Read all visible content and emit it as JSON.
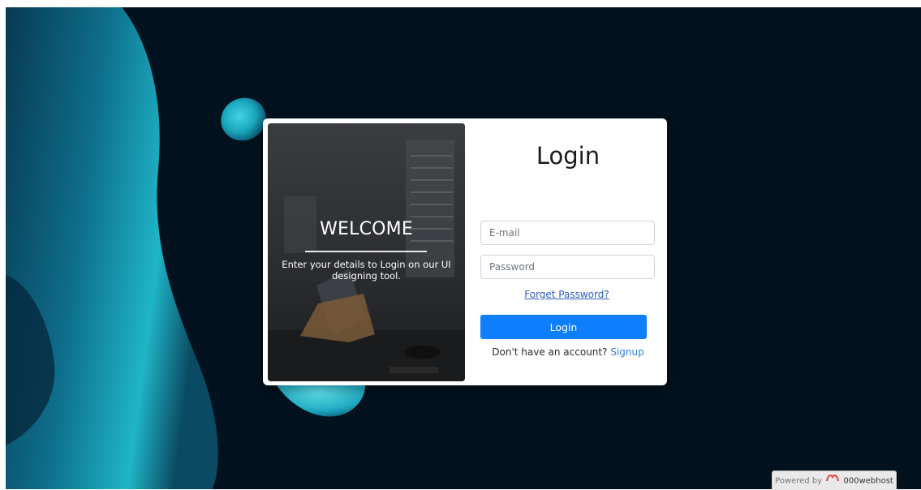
{
  "welcome": {
    "title": "WELCOME",
    "text": "Enter your details to Login on our UI designing tool."
  },
  "login_form": {
    "title": "Login",
    "email_placeholder": "E-mail",
    "password_placeholder": "Password",
    "forget_label": "Forget Password?",
    "button_label": "Login",
    "signup_prompt": "Don't have an account?",
    "signup_label": "Signup"
  },
  "footer": {
    "powered_by": "Powered by",
    "brand": "000webhost",
    "logo_icon": "webhost-logo-icon"
  },
  "colors": {
    "background": "#02121e",
    "accent_button": "#0d7efc",
    "link": "#2b5fbd",
    "blob": "#1fb5c7"
  }
}
